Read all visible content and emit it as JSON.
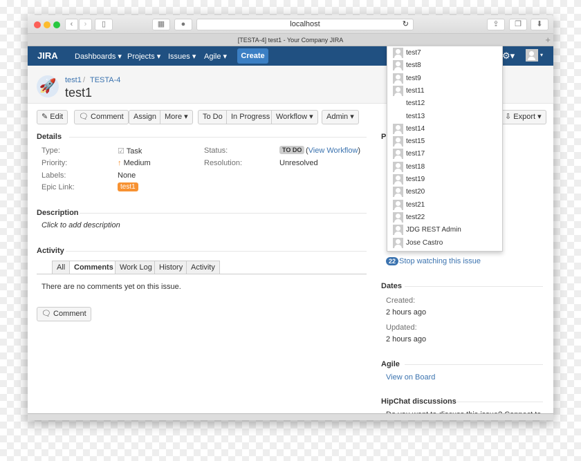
{
  "browser": {
    "url": "localhost",
    "tab_title": "[TESTA-4] test1 - Your Company JIRA"
  },
  "nav": {
    "logo": "JIRA",
    "items": [
      "Dashboards",
      "Projects",
      "Issues",
      "Agile"
    ],
    "create": "Create"
  },
  "issue": {
    "breadcrumb_project": "test1",
    "breadcrumb_key": "TESTA-4",
    "title": "test1"
  },
  "toolbar": {
    "edit": "Edit",
    "comment": "Comment",
    "assign": "Assign",
    "more": "More",
    "todo": "To Do",
    "in_progress": "In Progress",
    "workflow": "Workflow",
    "admin": "Admin",
    "export": "Export"
  },
  "details": {
    "heading": "Details",
    "type_label": "Type:",
    "type": "Task",
    "priority_label": "Priority:",
    "priority": "Medium",
    "labels_label": "Labels:",
    "labels": "None",
    "epic_label": "Epic Link:",
    "epic": "test1",
    "status_label": "Status:",
    "status": "TO DO",
    "view_workflow": "View Workflow",
    "resolution_label": "Resolution:",
    "resolution": "Unresolved"
  },
  "description": {
    "heading": "Description",
    "placeholder": "Click to add description"
  },
  "activity": {
    "heading": "Activity",
    "tabs": [
      "All",
      "Comments",
      "Work Log",
      "History",
      "Activity"
    ],
    "active_tab": "Comments",
    "empty": "There are no comments yet on this issue.",
    "comment_button": "Comment"
  },
  "watchers_dropdown": [
    {
      "name": "test7",
      "avatar": true
    },
    {
      "name": "test8",
      "avatar": true
    },
    {
      "name": "test9",
      "avatar": true
    },
    {
      "name": "test11",
      "avatar": true
    },
    {
      "name": "test12",
      "avatar": false
    },
    {
      "name": "test13",
      "avatar": false
    },
    {
      "name": "test14",
      "avatar": true
    },
    {
      "name": "test15",
      "avatar": true
    },
    {
      "name": "test17",
      "avatar": true
    },
    {
      "name": "test18",
      "avatar": true
    },
    {
      "name": "test19",
      "avatar": true
    },
    {
      "name": "test20",
      "avatar": true
    },
    {
      "name": "test21",
      "avatar": true
    },
    {
      "name": "test22",
      "avatar": true
    },
    {
      "name": "JDG REST Admin",
      "avatar": true
    },
    {
      "name": "Jose Castro",
      "avatar": true
    }
  ],
  "side": {
    "people_initial": "P",
    "watch_count": "22",
    "stop_watching": "Stop watching this issue",
    "dates_heading": "Dates",
    "created_label": "Created:",
    "created": "2 hours ago",
    "updated_label": "Updated:",
    "updated": "2 hours ago",
    "agile_heading": "Agile",
    "view_on_board": "View on Board",
    "hipchat_heading": "HipChat discussions",
    "hipchat_text": "Do you want to discuss this issue? Connect to"
  },
  "colors": {
    "nav": "#205081",
    "create": "#3b7fc4",
    "link": "#3b73af",
    "epic": "#f79232"
  }
}
